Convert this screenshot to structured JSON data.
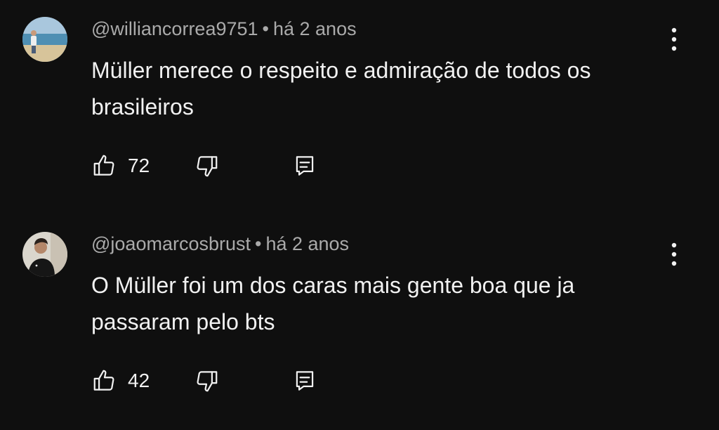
{
  "comments": [
    {
      "author": "@williancorrea9751",
      "separator": "•",
      "time": "há 2 anos",
      "text": "Müller merece o respeito e admiração de todos os brasileiros",
      "likes": "72"
    },
    {
      "author": "@joaomarcosbrust",
      "separator": "•",
      "time": "há 2 anos",
      "text": "O Müller foi um dos caras mais gente boa que ja passaram pelo bts",
      "likes": "42"
    }
  ],
  "icons": {
    "like": "thumbs-up-icon",
    "dislike": "thumbs-down-icon",
    "reply": "reply-icon",
    "menu": "more-vert-icon"
  },
  "colors": {
    "background": "#0f0f0f",
    "text": "#f1f1f1",
    "meta": "#aaaaaa"
  }
}
